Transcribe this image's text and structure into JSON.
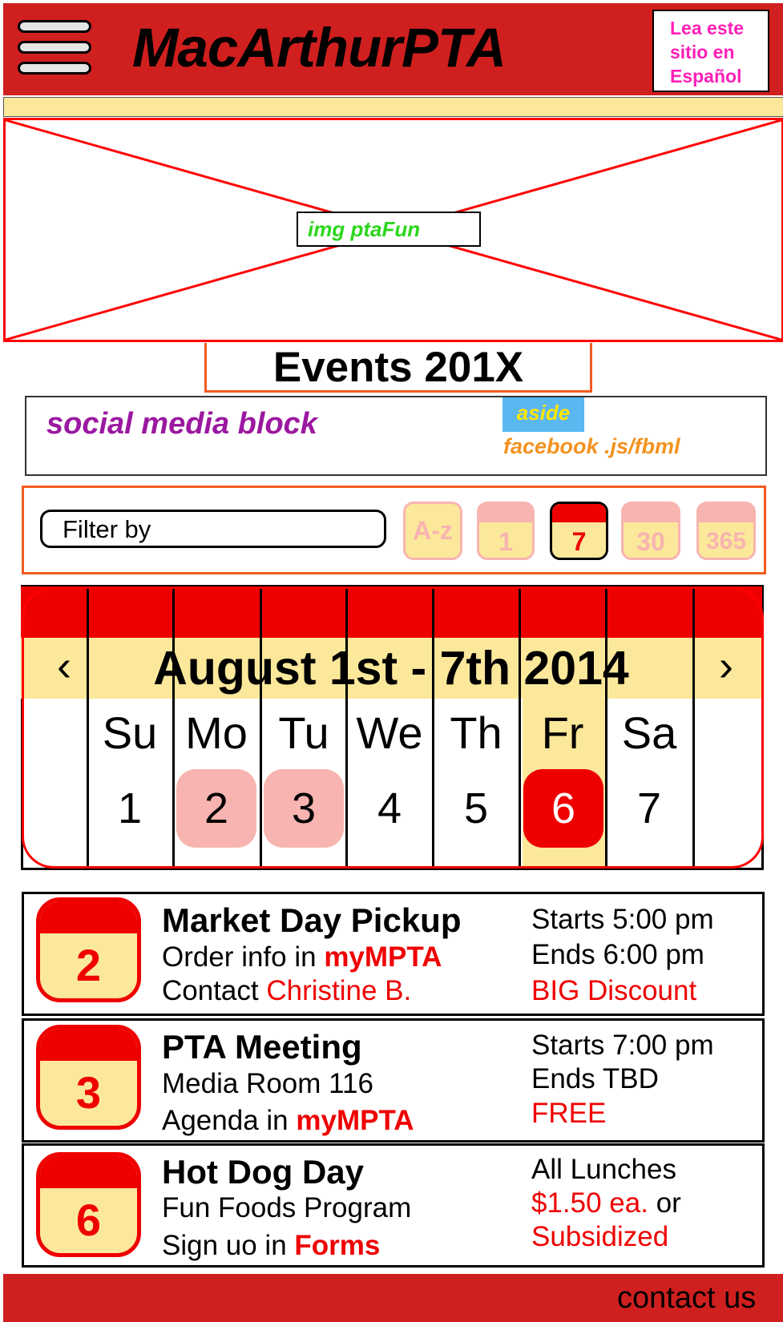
{
  "header": {
    "title": "MacArthurPTA",
    "language_link": [
      "Lea este",
      "sitio en",
      "Español"
    ]
  },
  "hero": {
    "placeholder_label": "img ptaFun"
  },
  "events_heading": "Events 201X",
  "social": {
    "label": "social media block",
    "aside_tag": "aside",
    "facebook": "facebook .js/fbml"
  },
  "filter": {
    "placeholder": "Filter by",
    "buttons": [
      "A-z",
      "1",
      "7",
      "30",
      "365"
    ],
    "selected": "7"
  },
  "calendar": {
    "range": "August 1st  - 7th 2014",
    "prev": "‹",
    "next": "›",
    "days": [
      {
        "name": "Su",
        "num": "1"
      },
      {
        "name": "Mo",
        "num": "2"
      },
      {
        "name": "Tu",
        "num": "3"
      },
      {
        "name": "We",
        "num": "4"
      },
      {
        "name": "Th",
        "num": "5"
      },
      {
        "name": "Fr",
        "num": "6"
      },
      {
        "name": "Sa",
        "num": "7"
      }
    ]
  },
  "events": [
    {
      "day": "2",
      "title": "Market Day Pickup",
      "line1_text": "Order info in ",
      "line1_link": "myMPTA",
      "line2_text": "Contact ",
      "line2_link": "Christine B.",
      "right1": "Starts 5:00 pm",
      "right2": "Ends 6:00 pm",
      "right3": "BIG Discount"
    },
    {
      "day": "3",
      "title": "PTA Meeting",
      "line1_text": "Media Room 116",
      "line2_text": "Agenda in ",
      "line2_link": "myMPTA",
      "right1": "Starts 7:00 pm",
      "right2": "Ends TBD",
      "right3": "FREE"
    },
    {
      "day": "6",
      "title": "Hot Dog Day",
      "line1_text": "Fun Foods Program",
      "line2_text": "Sign uo in  ",
      "line2_link": "Forms",
      "right1": "All Lunches",
      "right2_price": "$1.50 ea.",
      "right2_tail": " or",
      "right3": "Subsidized"
    }
  ],
  "footer": {
    "contact": "contact us"
  },
  "colors": {
    "brand_red": "#d01f1f",
    "accent_red": "#ef0000",
    "yellow": "#fbe89a",
    "pink": "#f8b4b0"
  }
}
